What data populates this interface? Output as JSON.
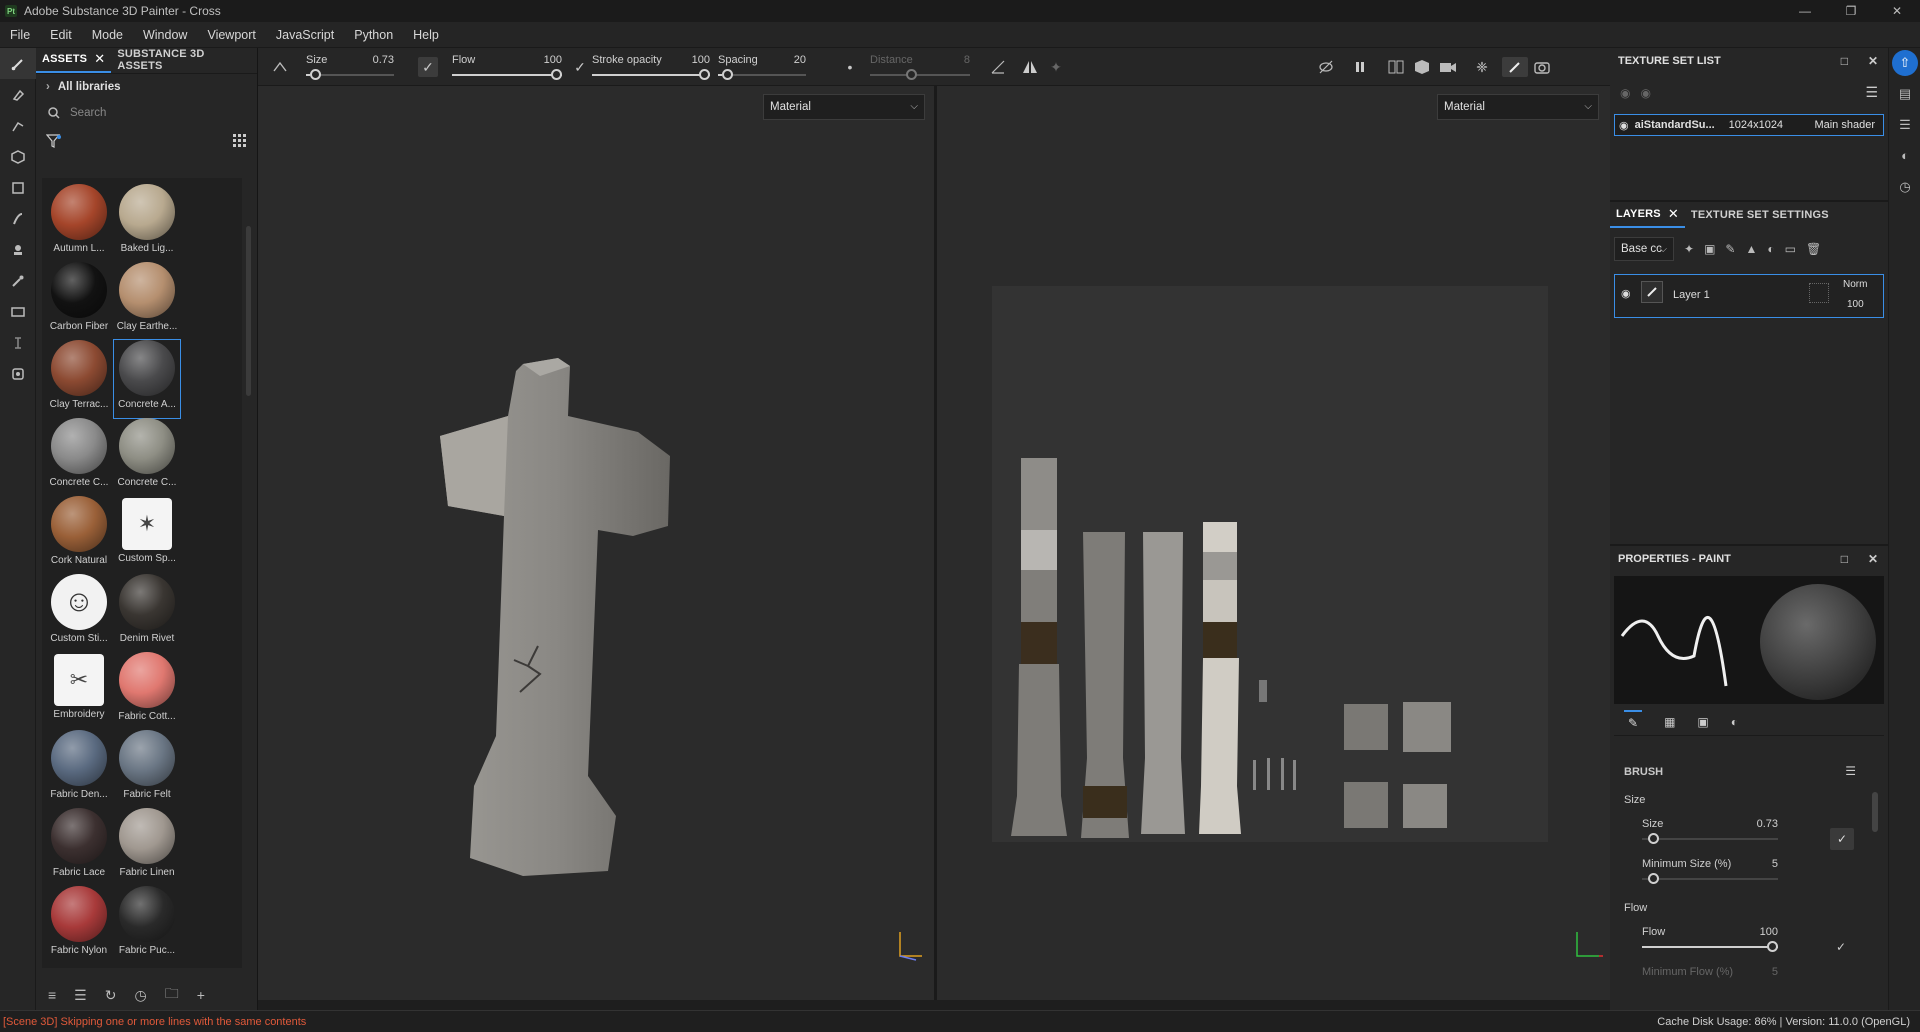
{
  "app": {
    "title": "Adobe Substance 3D Painter - Cross",
    "logo": "Pt"
  },
  "menu": [
    "File",
    "Edit",
    "Mode",
    "Window",
    "Viewport",
    "JavaScript",
    "Python",
    "Help"
  ],
  "assets": {
    "tabs": [
      "ASSETS",
      "SUBSTANCE 3D ASSETS"
    ],
    "library": "All libraries",
    "search_placeholder": "Search",
    "items": [
      {
        "label": "Autumn L...",
        "color": "#a5452a"
      },
      {
        "label": "Baked Lig...",
        "color": "#b8a98f"
      },
      {
        "label": "Carbon Fiber",
        "color": "#121212"
      },
      {
        "label": "Clay Earthe...",
        "color": "#b58f6f"
      },
      {
        "label": "Clay Terrac...",
        "color": "#8c4a32"
      },
      {
        "label": "Concrete A...",
        "color": "#4a4a4c"
      },
      {
        "label": "Concrete C...",
        "color": "#8a8a8a"
      },
      {
        "label": "Concrete C...",
        "color": "#8e8e84"
      },
      {
        "label": "Cork Natural",
        "color": "#9a6038"
      },
      {
        "label": "Custom Sp...",
        "color": "#f2f2f2"
      },
      {
        "label": "Custom Sti...",
        "color": "#f2f2f2"
      },
      {
        "label": "Denim Rivet",
        "color": "#3a3632"
      },
      {
        "label": "Embroidery",
        "color": "#f2f2f2"
      },
      {
        "label": "Fabric Cott...",
        "color": "#e07870"
      },
      {
        "label": "Fabric Den...",
        "color": "#5a6a80"
      },
      {
        "label": "Fabric Felt",
        "color": "#6a7684"
      },
      {
        "label": "Fabric Lace",
        "color": "#3c3030"
      },
      {
        "label": "Fabric Linen",
        "color": "#a09890"
      },
      {
        "label": "Fabric Nylon",
        "color": "#a83a3a"
      },
      {
        "label": "Fabric Puc...",
        "color": "#2a2a2a"
      }
    ]
  },
  "toolbar": {
    "size_label": "Size",
    "size_value": "0.73",
    "size_level": 0.05,
    "flow_label": "Flow",
    "flow_value": "100",
    "flow_level": 1.0,
    "opacity_label": "Stroke opacity",
    "opacity_value": "100",
    "opacity_level": 1.0,
    "spacing_label": "Spacing",
    "spacing_value": "20",
    "spacing_level": 0.05,
    "distance_label": "Distance",
    "distance_value": "8",
    "distance_level": 0.4
  },
  "viewports": {
    "left_mode": "Material",
    "right_mode": "Material"
  },
  "texture_set_list": {
    "title": "TEXTURE SET LIST",
    "name": "aiStandardSu...",
    "resolution": "1024x1024",
    "shader": "Main shader"
  },
  "layers": {
    "tabs": [
      "LAYERS",
      "TEXTURE SET SETTINGS"
    ],
    "channel": "Base cc",
    "layer_name": "Layer 1",
    "blend": "Norm",
    "opacity": "100"
  },
  "properties": {
    "title": "PROPERTIES - PAINT",
    "brush_title": "BRUSH",
    "size_group": "Size",
    "size_label": "Size",
    "size_value": "0.73",
    "size_level": 0.05,
    "min_size_label": "Minimum Size (%)",
    "min_size_value": "5",
    "min_size_level": 0.05,
    "flow_group": "Flow",
    "flow_label": "Flow",
    "flow_value": "100",
    "flow_level": 1.0,
    "min_flow_label": "Minimum Flow (%)",
    "min_flow_value": "5"
  },
  "status": {
    "error": "[Scene 3D] Skipping one or more lines with the same contents",
    "right": "Cache Disk Usage:   86% | Version: 11.0.0 (OpenGL)"
  },
  "colors": {
    "accent": "#3a8ee6",
    "error": "#e0593a"
  }
}
